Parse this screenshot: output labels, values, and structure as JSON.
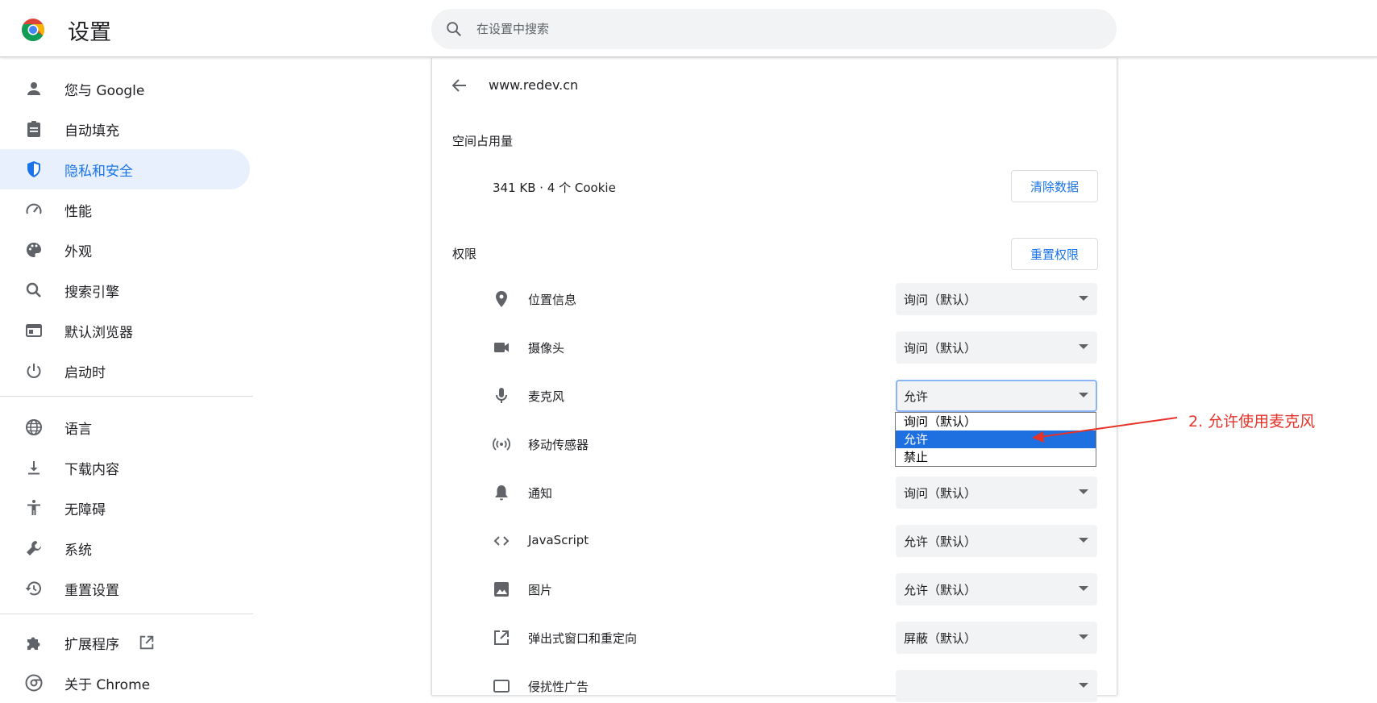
{
  "header": {
    "title": "设置",
    "search_placeholder": "在设置中搜索"
  },
  "sidebar": {
    "items": [
      {
        "label": "您与 Google",
        "icon": "person-icon"
      },
      {
        "label": "自动填充",
        "icon": "clipboard-icon"
      },
      {
        "label": "隐私和安全",
        "icon": "shield-icon",
        "active": true
      },
      {
        "label": "性能",
        "icon": "speedometer-icon"
      },
      {
        "label": "外观",
        "icon": "palette-icon"
      },
      {
        "label": "搜索引擎",
        "icon": "search-icon"
      },
      {
        "label": "默认浏览器",
        "icon": "browser-window-icon"
      },
      {
        "label": "启动时",
        "icon": "power-icon"
      },
      {
        "label": "语言",
        "icon": "globe-icon"
      },
      {
        "label": "下载内容",
        "icon": "download-icon"
      },
      {
        "label": "无障碍",
        "icon": "accessibility-icon"
      },
      {
        "label": "系统",
        "icon": "wrench-icon"
      },
      {
        "label": "重置设置",
        "icon": "history-icon"
      },
      {
        "label": "扩展程序",
        "icon": "puzzle-icon"
      },
      {
        "label": "关于 Chrome",
        "icon": "chrome-icon"
      }
    ]
  },
  "site": {
    "name": "www.redev.cn",
    "usage_title": "空间占用量",
    "usage_text": "341 KB · 4 个 Cookie",
    "clear_button": "清除数据",
    "permissions_title": "权限",
    "reset_button": "重置权限",
    "permissions": [
      {
        "label": "位置信息",
        "value": "询问（默认）",
        "icon": "location-pin-icon"
      },
      {
        "label": "摄像头",
        "value": "询问（默认）",
        "icon": "camera-icon"
      },
      {
        "label": "麦克风",
        "value": "允许",
        "icon": "microphone-icon",
        "focused": true
      },
      {
        "label": "移动传感器",
        "value": "",
        "icon": "motion-sensor-icon"
      },
      {
        "label": "通知",
        "value": "询问（默认）",
        "icon": "bell-icon"
      },
      {
        "label": "JavaScript",
        "value": "允许（默认）",
        "icon": "code-icon"
      },
      {
        "label": "图片",
        "value": "允许（默认）",
        "icon": "image-icon"
      },
      {
        "label": "弹出式窗口和重定向",
        "value": "屏蔽（默认）",
        "icon": "open-in-new-icon"
      },
      {
        "label": "侵扰性广告",
        "value": "",
        "icon": "ads-icon"
      }
    ]
  },
  "dropdown": {
    "options": [
      "询问（默认）",
      "允许",
      "禁止"
    ],
    "selected_index": 1
  },
  "annotation": {
    "text": "2. 允许使用麦克风",
    "color": "#e5332a"
  },
  "colors": {
    "accent": "#1a73e8",
    "active_bg": "#e8f0fe",
    "select_bg": "#f1f3f4"
  }
}
